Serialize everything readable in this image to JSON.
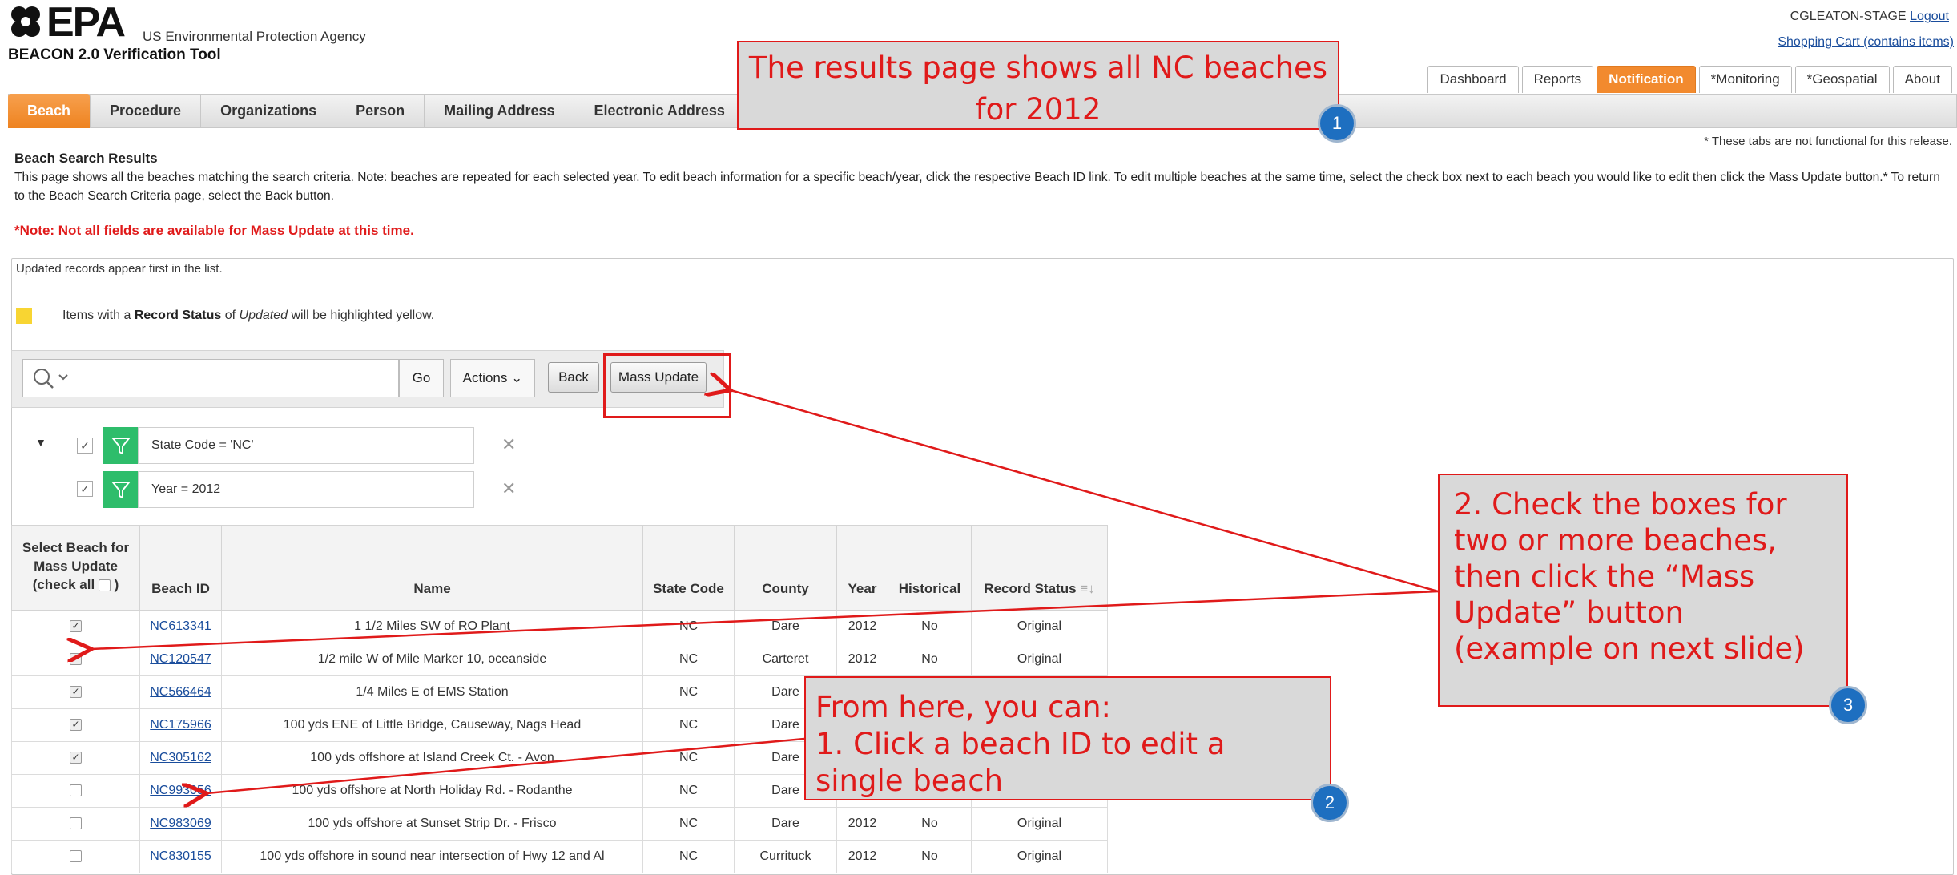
{
  "header": {
    "logo_text": "EPA",
    "agency": "US Environmental Protection Agency",
    "tool_name": "BEACON 2.0 Verification Tool",
    "user": "CGLEATON-STAGE",
    "logout": "Logout",
    "cart": "Shopping Cart (contains items)"
  },
  "top_tabs": [
    "Dashboard",
    "Reports",
    "Notification",
    "*Monitoring",
    "*Geospatial",
    "About"
  ],
  "top_tab_active": "Notification",
  "nav_tabs": [
    "Beach",
    "Procedure",
    "Organizations",
    "Person",
    "Mailing Address",
    "Electronic Address"
  ],
  "nav_note": "* These tabs are not functional for this release.",
  "page": {
    "heading": "Beach Search Results",
    "description": "This page shows all the beaches matching the search criteria. Note: beaches are repeated for each selected year. To edit beach information for a specific beach/year, click the respective Beach ID link. To edit multiple beaches at the same time, select the check box next to each beach you would like to edit then click the Mass Update button.* To return to the Beach Search Criteria page, select the Back button.",
    "mass_note": "*Note: Not all fields are available for Mass Update at this time.",
    "updated_note": "Updated records appear first in the list.",
    "legend_prefix": "Items with a ",
    "legend_bold": "Record Status",
    "legend_mid": " of ",
    "legend_italic": "Updated",
    "legend_suffix": " will be highlighted yellow."
  },
  "toolbar": {
    "go": "Go",
    "actions": "Actions",
    "back": "Back",
    "mass_update": "Mass Update"
  },
  "filters": [
    "State Code = 'NC'",
    "Year = 2012"
  ],
  "table": {
    "select_header": [
      "Select Beach for",
      "Mass Update",
      "(check all"
    ],
    "select_header_close": " )",
    "columns": [
      "Beach ID",
      "Name",
      "State Code",
      "County",
      "Year",
      "Historical",
      "Record Status"
    ],
    "rows": [
      {
        "checked": true,
        "id": "NC613341",
        "name": "1 1/2 Miles SW of RO Plant",
        "state": "NC",
        "county": "Dare",
        "year": "2012",
        "historical": "No",
        "status": "Original"
      },
      {
        "checked": true,
        "id": "NC120547",
        "name": "1/2 mile W of Mile Marker 10, oceanside",
        "state": "NC",
        "county": "Carteret",
        "year": "2012",
        "historical": "No",
        "status": "Original"
      },
      {
        "checked": true,
        "id": "NC566464",
        "name": "1/4 Miles E of EMS Station",
        "state": "NC",
        "county": "Dare",
        "year": "",
        "historical": "",
        "status": ""
      },
      {
        "checked": true,
        "id": "NC175966",
        "name": "100 yds ENE of Little Bridge, Causeway, Nags Head",
        "state": "NC",
        "county": "Dare",
        "year": "",
        "historical": "",
        "status": ""
      },
      {
        "checked": true,
        "id": "NC305162",
        "name": "100 yds offshore at Island Creek Ct. - Avon",
        "state": "NC",
        "county": "Dare",
        "year": "",
        "historical": "",
        "status": ""
      },
      {
        "checked": false,
        "id": "NC993056",
        "name": "100 yds offshore at North Holiday Rd. - Rodanthe",
        "state": "NC",
        "county": "Dare",
        "year": "",
        "historical": "",
        "status": ""
      },
      {
        "checked": false,
        "id": "NC983069",
        "name": "100 yds offshore at Sunset Strip Dr. - Frisco",
        "state": "NC",
        "county": "Dare",
        "year": "2012",
        "historical": "No",
        "status": "Original"
      },
      {
        "checked": false,
        "id": "NC830155",
        "name": "100 yds offshore in sound near intersection of Hwy 12 and Al",
        "state": "NC",
        "county": "Currituck",
        "year": "2012",
        "historical": "No",
        "status": "Original"
      }
    ]
  },
  "callouts": {
    "one": "The results page shows all NC beaches for 2012",
    "two_lines": [
      "From here, you can:",
      "1. Click a beach ID to edit a",
      "single beach"
    ],
    "three_lines": [
      "2. Check the boxes for",
      "two or more beaches,",
      "then click the “Mass",
      "Update” button",
      "(example on next slide)"
    ],
    "badge_1": "1",
    "badge_2": "2",
    "badge_3": "3"
  },
  "colors": {
    "accent_orange": "#f28a2e",
    "annotation_red": "#e01a1a",
    "badge_blue": "#1e6fc0",
    "filter_green": "#2ebd6b",
    "legend_yellow": "#f8d532"
  }
}
